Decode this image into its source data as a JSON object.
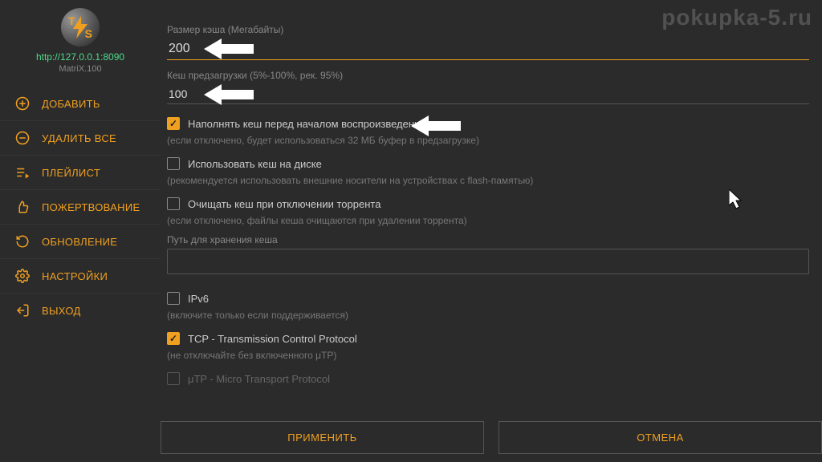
{
  "watermark": "pokupka-5.ru",
  "sidebar": {
    "url": "http://127.0.0.1:8090",
    "subtitle": "MatriX.100",
    "items": [
      {
        "label": "ДОБАВИТЬ"
      },
      {
        "label": "УДАЛИТЬ ВСЕ"
      },
      {
        "label": "ПЛЕЙЛИСТ"
      },
      {
        "label": "ПОЖЕРТВОВАНИЕ"
      },
      {
        "label": "ОБНОВЛЕНИЕ"
      },
      {
        "label": "НАСТРОЙКИ"
      },
      {
        "label": "ВЫХОД"
      }
    ]
  },
  "settings": {
    "cache_size_label": "Размер кэша (Мегабайты)",
    "cache_size_value": "200",
    "preload_label": "Кеш предзагрузки (5%-100%, рек. 95%)",
    "preload_value": "100",
    "fill_cache_label": "Наполнять кеш перед началом воспроизведения",
    "fill_cache_hint": "(если отключено, будет использоваться 32 МБ буфер в предзагрузке)",
    "disk_cache_label": "Использовать кеш на диске",
    "disk_cache_hint": "(рекомендуется использовать внешние носители на устройствах с flash-памятью)",
    "clear_cache_label": "Очищать кеш при отключении торрента",
    "clear_cache_hint": "(если отключено, файлы кеша очищаются при удалении торрента)",
    "storage_path_label": "Путь для хранения кеша",
    "ipv6_label": "IPv6",
    "ipv6_hint": "(включите только если поддерживается)",
    "tcp_label": "TCP - Transmission Control Protocol",
    "tcp_hint": "(не отключайте без включенного μTP)",
    "utp_label": "μTP - Micro Transport Protocol"
  },
  "buttons": {
    "apply": "ПРИМЕНИТЬ",
    "cancel": "ОТМЕНА"
  }
}
